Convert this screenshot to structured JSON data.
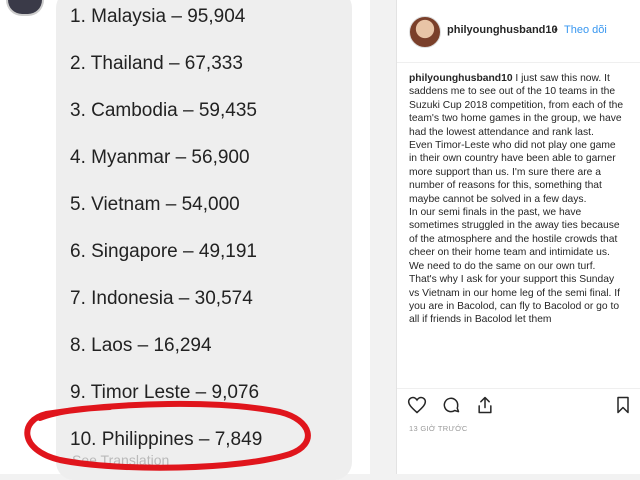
{
  "list": {
    "items": [
      "1. Malaysia – 95,904",
      "2. Thailand – 67,333",
      "3. Cambodia – 59,435",
      "4. Myanmar – 56,900",
      "5. Vietnam – 54,000",
      "6. Singapore – 49,191",
      "7. Indonesia – 30,574",
      "8. Laos – 16,294",
      "9. Timor Leste – 9,076",
      "10. Philippines – 7,849"
    ],
    "see_translation": "See Translation",
    "highlight_color": "#e0151c"
  },
  "post": {
    "username": "philyounghusband10",
    "separator": "•",
    "follow_label": "Theo dõi",
    "follow_color": "#3897f0",
    "caption_user": "philyounghusband10",
    "caption_paragraphs": [
      "I just saw this now. It saddens me to see out of the 10 teams in the Suzuki Cup 2018 competition, from each of the team's two home games in the group, we have had the lowest attendance and rank last.",
      "Even Timor-Leste who did not play one game in their own country have been able to garner more support than us. I'm sure there are a number of reasons for this, something that maybe cannot be solved in a few days.",
      "In our semi finals in the past, we have sometimes struggled in the away ties because of the atmosphere and the hostile crowds that cheer on their home team and intimidate us. We need to do the same on our own turf.",
      "That's why I ask for your support this Sunday vs Vietnam in our home leg of the semi final. If you are in Bacolod, can fly to Bacolod or go to all if friends in Bacolod let them"
    ],
    "time_ago": "13 GIỜ TRƯỚC",
    "icons": [
      "heart-icon",
      "comment-icon",
      "share-icon",
      "bookmark-icon"
    ]
  }
}
